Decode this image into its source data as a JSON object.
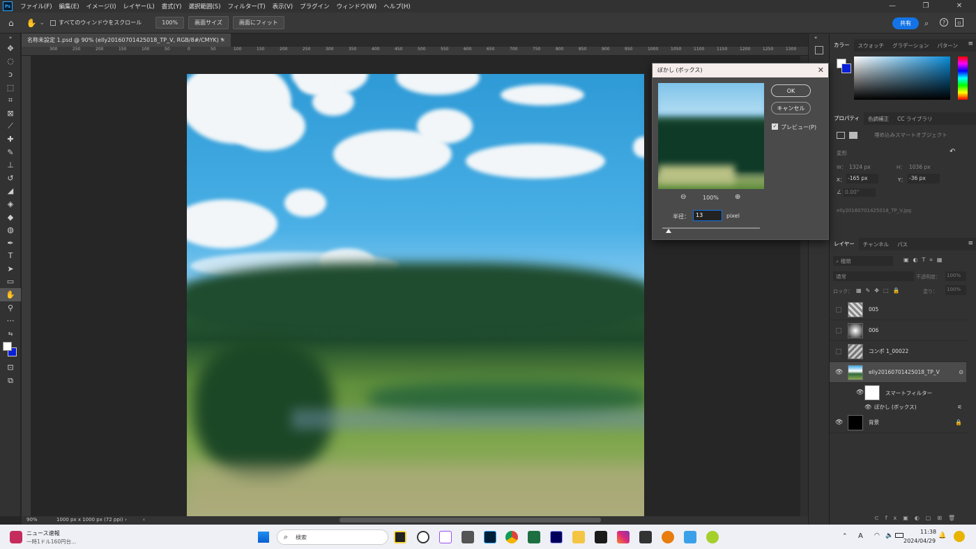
{
  "menubar": {
    "logo": "Ps",
    "items": [
      "ファイル(F)",
      "編集(E)",
      "イメージ(I)",
      "レイヤー(L)",
      "書式(Y)",
      "選択範囲(S)",
      "フィルター(T)",
      "表示(V)",
      "プラグイン",
      "ウィンドウ(W)",
      "ヘルプ(H)"
    ],
    "win_min": "—",
    "win_max": "❐",
    "win_close": "✕"
  },
  "options": {
    "scroll_all_label": "すべてのウィンドウをスクロール",
    "zoom_btn": "100%",
    "fit_screen": "画面サイズ",
    "fill_screen": "画面にフィット",
    "share": "共有"
  },
  "document": {
    "tab_title": "名称未設定 1.psd @ 90% (elly20160701425018_TP_V, RGB/8#/CMYK) *",
    "zoom": "90%",
    "doc_info": "1000 px x 1000 px (72 ppi)"
  },
  "ruler": [
    "300",
    "250",
    "200",
    "150",
    "100",
    "50",
    "0",
    "50",
    "100",
    "150",
    "200",
    "250",
    "300",
    "350",
    "400",
    "450",
    "500",
    "550",
    "600",
    "650",
    "700",
    "750",
    "800",
    "850",
    "900",
    "950",
    "1000",
    "1050",
    "1100",
    "1150",
    "1200",
    "1250",
    "1300"
  ],
  "dialog": {
    "title": "ぼかし (ボックス)",
    "ok": "OK",
    "cancel": "キャンセル",
    "preview_label": "プレビュー(P)",
    "zoom": "100%",
    "radius_label": "半径：",
    "radius_value": "13",
    "unit": "pixel"
  },
  "color_panel": {
    "tabs": [
      "カラー",
      "スウォッチ",
      "グラデーション",
      "パターン"
    ]
  },
  "properties": {
    "tabs": [
      "プロパティ",
      "色調補正",
      "CC ライブラリ"
    ],
    "type": "埋め込みスマートオブジェクト",
    "section": "変形",
    "w_label": "W：",
    "w": "1324 px",
    "h_label": "H：",
    "h": "1036 px",
    "x_label": "X：",
    "x": "-165 px",
    "y_label": "Y：",
    "y": "-36 px",
    "angle": "0.00°",
    "filename": "elly20160701425018_TP_V.jpg"
  },
  "layers": {
    "tabs": [
      "レイヤー",
      "チャンネル",
      "パス"
    ],
    "search": "種類",
    "blend": "通常",
    "opacity_label": "不透明度：",
    "opacity": "100%",
    "lock_label": "ロック：",
    "fill_label": "塗り：",
    "fill": "100%",
    "items": [
      {
        "name": "005"
      },
      {
        "name": "006"
      },
      {
        "name": "コンポ 1_00022"
      },
      {
        "name": "elly20160701425018_TP_V"
      },
      {
        "name": "スマートフィルター"
      },
      {
        "name": "ぼかし (ボックス)"
      },
      {
        "name": "背景"
      }
    ]
  },
  "taskbar": {
    "news_title": "ニュース速報",
    "news_sub": "一時1ドル160円台...",
    "search": "検索",
    "time": "11:38",
    "date": "2024/04/29",
    "ime": "A"
  },
  "colors": {
    "accent": "#1473e6",
    "fg_swatch": "#0a1fd8",
    "bg_swatch": "#ffffff"
  }
}
